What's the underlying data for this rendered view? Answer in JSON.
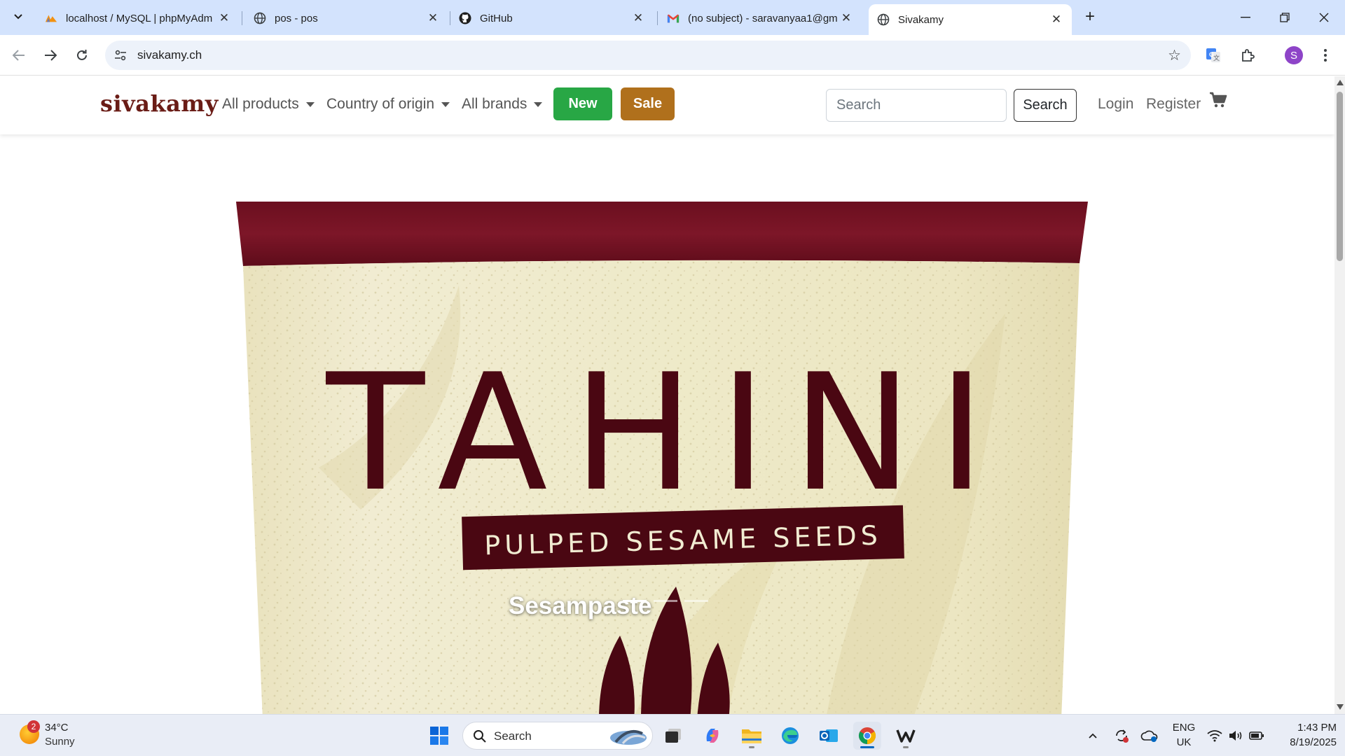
{
  "browser": {
    "tabs": [
      {
        "title": "localhost / MySQL | phpMyAdm",
        "favicon": "phpmyadmin-icon",
        "active": false
      },
      {
        "title": "pos - pos",
        "favicon": "globe-icon",
        "active": false
      },
      {
        "title": "GitHub",
        "favicon": "github-icon",
        "active": false
      },
      {
        "title": "(no subject) - saravanyaa1@gm",
        "favicon": "gmail-icon",
        "active": false
      },
      {
        "title": "Sivakamy",
        "favicon": "globe-icon",
        "active": true
      }
    ],
    "url": "sivakamy.ch",
    "profile_initial": "S"
  },
  "site": {
    "brand": "sivakamy",
    "nav": {
      "all_products": "All products",
      "country_of_origin": "Country of origin",
      "all_brands": "All brands",
      "new_label": "New",
      "sale_label": "Sale",
      "search_placeholder": "Search",
      "search_button": "Search",
      "login": "Login",
      "register": "Register"
    },
    "colors": {
      "brand": "#6a1c16",
      "new_button": "#28a745",
      "sale_button": "#b0701c"
    },
    "hero": {
      "product_title": "TAHINI",
      "product_subtitle": "PULPED SESAME SEEDS",
      "caption": "Sesampaste",
      "slide_count": 3,
      "active_slide": 0
    }
  },
  "taskbar": {
    "weather": {
      "temp": "34°C",
      "condition": "Sunny",
      "badge": "2"
    },
    "search_label": "Search",
    "language": {
      "line1": "ENG",
      "line2": "UK"
    },
    "time": "1:43 PM",
    "date": "8/19/2025"
  }
}
